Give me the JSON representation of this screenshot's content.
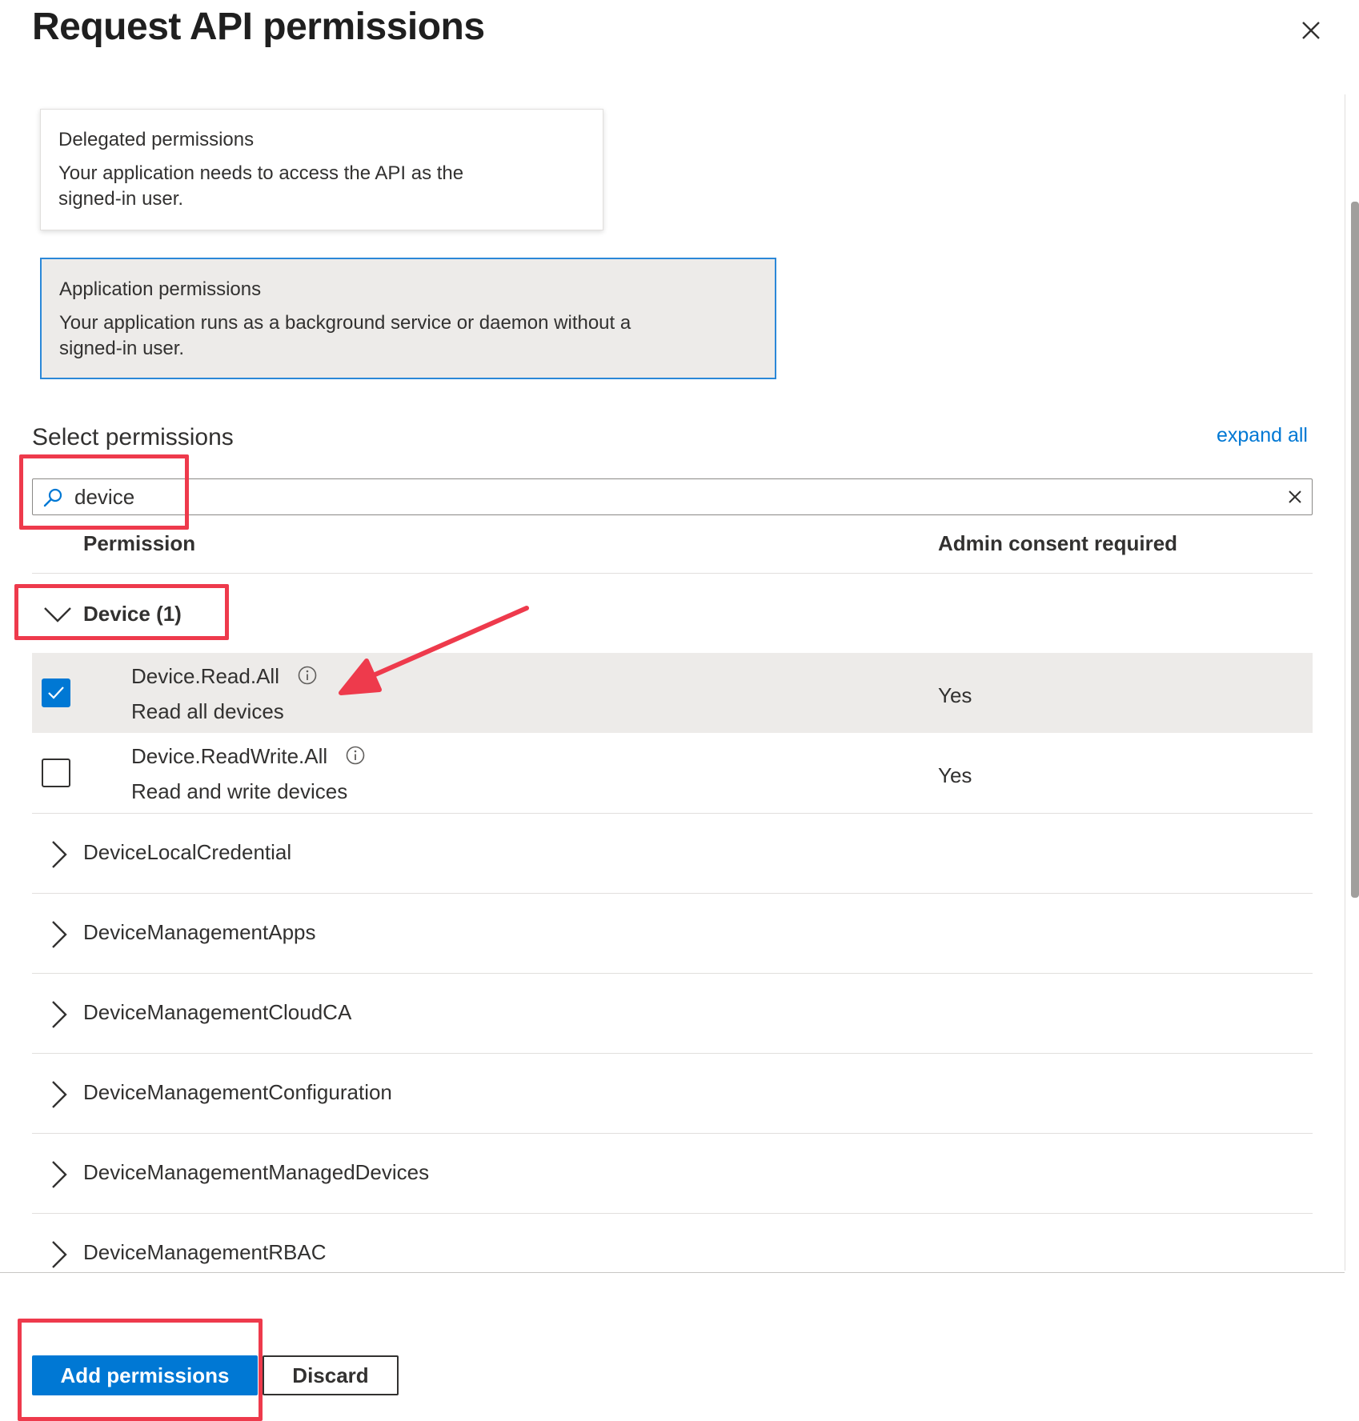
{
  "panel": {
    "title": "Request API permissions"
  },
  "permission_types": [
    {
      "title": "Delegated permissions",
      "description": "Your application needs to access the API as the signed-in user.",
      "selected": false
    },
    {
      "title": "Application permissions",
      "description": "Your application runs as a background service or daemon without a signed-in user.",
      "selected": true
    }
  ],
  "select_permissions": {
    "label": "Select permissions",
    "expand_all": "expand all"
  },
  "search": {
    "value": "device"
  },
  "columns": {
    "permission": "Permission",
    "admin_consent": "Admin consent required"
  },
  "expanded_group": {
    "label": "Device (1)",
    "permissions": [
      {
        "name": "Device.Read.All",
        "description": "Read all devices",
        "admin_consent": "Yes",
        "checked": true
      },
      {
        "name": "Device.ReadWrite.All",
        "description": "Read and write devices",
        "admin_consent": "Yes",
        "checked": false
      }
    ]
  },
  "collapsed_groups": [
    "DeviceLocalCredential",
    "DeviceManagementApps",
    "DeviceManagementCloudCA",
    "DeviceManagementConfiguration",
    "DeviceManagementManagedDevices",
    "DeviceManagementRBAC"
  ],
  "footer": {
    "primary_label": "Add permissions",
    "secondary_label": "Discard"
  },
  "colors": {
    "accent": "#0078d4",
    "annotation": "#ee3a4c",
    "selected_bg": "#edebe9"
  }
}
